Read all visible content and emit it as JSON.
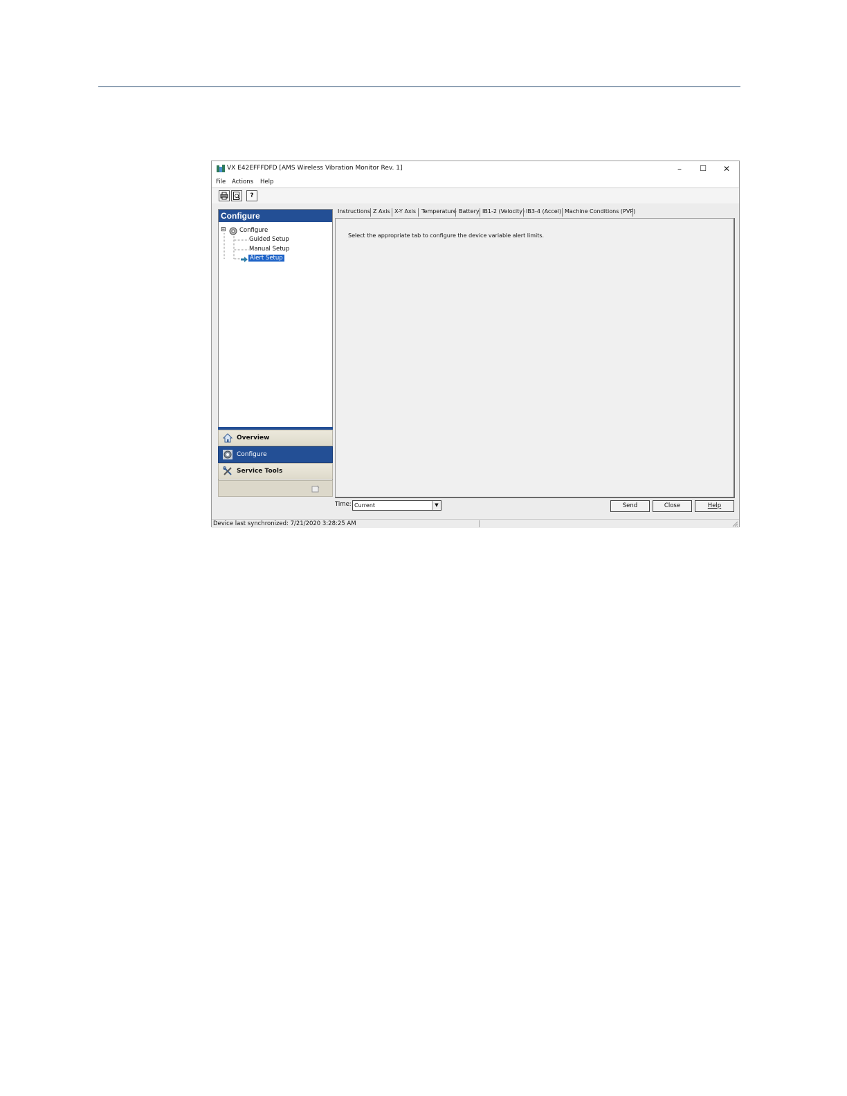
{
  "window": {
    "title": "VX E42EFFFDFD [AMS Wireless Vibration Monitor Rev. 1]",
    "controls": {
      "minimize": "–",
      "maximize": "☐",
      "close": "✕"
    }
  },
  "menu": [
    "File",
    "Actions",
    "Help"
  ],
  "toolbar": {
    "buttons": [
      {
        "name": "print-icon",
        "glyph": "⎙"
      },
      {
        "name": "print-preview-icon",
        "glyph": "🔍"
      },
      {
        "name": "context-help-icon",
        "glyph": "?"
      }
    ]
  },
  "sidebar": {
    "header": "Configure",
    "tree": {
      "root": "Configure",
      "expander": "⊟",
      "children": [
        "Guided Setup",
        "Manual Setup",
        "Alert Setup"
      ],
      "selected": "Alert Setup"
    },
    "nav": [
      {
        "label": "Overview",
        "icon": "home-icon"
      },
      {
        "label": "Configure",
        "icon": "gear-icon",
        "selected": true
      },
      {
        "label": "Service Tools",
        "icon": "tools-icon"
      }
    ]
  },
  "tabs": [
    "Instructions",
    "Z Axis",
    "X-Y Axis",
    "Temperature",
    "Battery",
    "IB1-2 (Velocity)",
    "IB3-4 (Accel)",
    "Machine Conditions (PVP)"
  ],
  "content": {
    "instruction": "Select the appropriate tab to configure the device variable alert limits."
  },
  "footer": {
    "time_label": "Time:",
    "time_value": "Current",
    "buttons": {
      "send": "Send",
      "close": "Close",
      "help": "Help"
    }
  },
  "status": {
    "text": "Device last synchronized: 7/21/2020 3:28:25 AM"
  },
  "colors": {
    "accent": "#234f95",
    "selection": "#1c62c7",
    "rule": "#2c4f73"
  }
}
